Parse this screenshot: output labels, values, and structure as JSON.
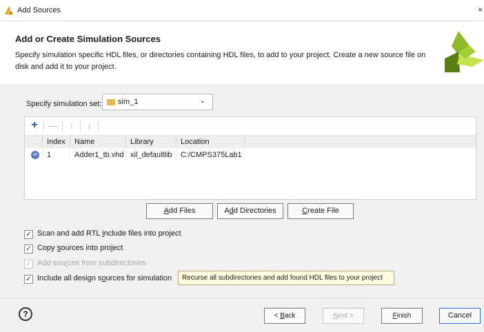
{
  "window": {
    "title": "Add Sources",
    "close": "×"
  },
  "header": {
    "title": "Add or Create Simulation Sources",
    "description": "Specify simulation specific HDL files, or directories containing HDL files, to add to your project. Create a new source file on disk and add it to your project."
  },
  "simset": {
    "label": "Specify simulation set:",
    "value": "sim_1",
    "chevron": "⌄"
  },
  "toolbar": {
    "add": "+",
    "remove": "—",
    "up": "↑",
    "down": "↓"
  },
  "table": {
    "columns": [
      "Index",
      "Name",
      "Library",
      "Location"
    ],
    "rows": [
      {
        "icon": "vhdl-file-icon",
        "badge": "vh",
        "index": "1",
        "name": "Adder1_tb.vhd",
        "library": "xil_defaultlib",
        "location": "C:/CMPS375Lab1"
      }
    ]
  },
  "buttons": {
    "add_files": {
      "pre": "",
      "u": "A",
      "post": "dd Files"
    },
    "add_dirs": {
      "pre": "A",
      "u": "d",
      "post": "d Directories"
    },
    "create_file": {
      "pre": "",
      "u": "C",
      "post": "reate File"
    }
  },
  "options": {
    "scan": {
      "pre": "Scan and add RTL ",
      "u": "i",
      "post": "nclude files into project",
      "checked": true
    },
    "copy": {
      "pre": "Copy ",
      "u": "s",
      "post": "ources into project",
      "checked": true
    },
    "subdirs": {
      "pre": "Add sou",
      "u": "r",
      "post": "ces from subdirectories",
      "checked": true,
      "disabled": true
    },
    "include_all": {
      "pre": "Include all design s",
      "u": "o",
      "post": "urces for simulation",
      "checked": true
    }
  },
  "tooltip": "Recurse all subdirectories and add found HDL files to your project",
  "footer": {
    "help": "?",
    "back": {
      "pre": "< ",
      "u": "B",
      "post": "ack"
    },
    "next": {
      "pre": "",
      "u": "N",
      "post": "ext >"
    },
    "finish": {
      "pre": "",
      "u": "F",
      "post": "inish"
    },
    "cancel": "Cancel"
  },
  "colors": {
    "accent": "#2a6fd6",
    "logo_dark": "#5a7e12",
    "logo_light": "#b8dc3a",
    "tooltip_bg": "#fffbe0"
  }
}
